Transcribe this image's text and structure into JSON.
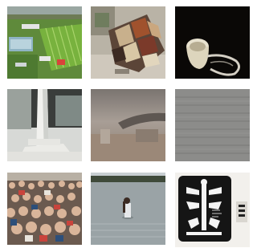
{
  "gallery": {
    "thumbnails": [
      {
        "subject": "aerial-campus-field-icon"
      },
      {
        "subject": "patchwork-sculpture-icon"
      },
      {
        "subject": "ceramic-mug-icon"
      },
      {
        "subject": "white-tower-structure-icon"
      },
      {
        "subject": "foggy-interior-icon"
      },
      {
        "subject": "gray-texture-icon"
      },
      {
        "subject": "crowd-icon"
      },
      {
        "subject": "person-in-water-icon"
      },
      {
        "subject": "tribal-artwork-icon"
      }
    ]
  }
}
